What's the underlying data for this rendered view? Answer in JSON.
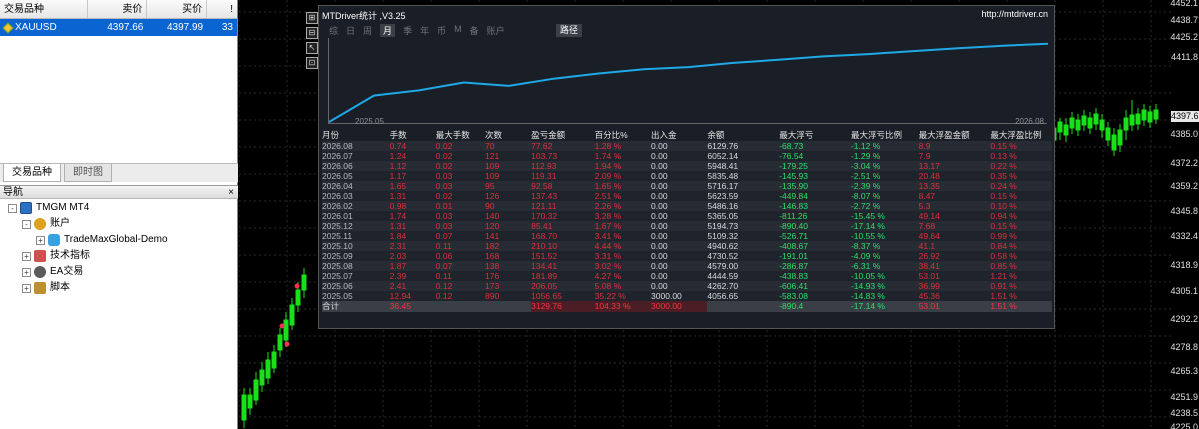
{
  "market_watch": {
    "headers": {
      "symbol": "交易品种",
      "bid": "卖价",
      "ask": "买价",
      "spread": "!"
    },
    "row": {
      "symbol": "XAUUSD",
      "bid": "4397.66",
      "ask": "4397.99",
      "spread": "33"
    },
    "tabs": [
      "交易品种",
      "即时图"
    ]
  },
  "navigator": {
    "title": "导航",
    "close": "×",
    "items": [
      {
        "label": "TMGM MT4",
        "level": 0,
        "expander": "-",
        "icon": "monitor-icon"
      },
      {
        "label": "账户",
        "level": 1,
        "expander": "-",
        "icon": "accounts-icon"
      },
      {
        "label": "TradeMaxGlobal-Demo",
        "level": 2,
        "expander": "+",
        "icon": "user-icon"
      },
      {
        "label": "技术指标",
        "level": 1,
        "expander": "+",
        "icon": "indicators-icon"
      },
      {
        "label": "EA交易",
        "level": 1,
        "expander": "+",
        "icon": "expert-icon"
      },
      {
        "label": "脚本",
        "level": 1,
        "expander": "+",
        "icon": "script-icon"
      }
    ]
  },
  "price_scale": {
    "ticks": [
      "4452.1",
      "4438.7",
      "4425.2",
      "4411.8",
      "4385.0",
      "4372.2",
      "4359.2",
      "4345.8",
      "4332.4",
      "4318.9",
      "4305.1",
      "4292.2",
      "4278.8",
      "4265.3",
      "4251.9",
      "4238.5",
      "4225.0"
    ],
    "current": "4397.6"
  },
  "toolbar": {
    "buttons": [
      "⊞",
      "⊟",
      "↖",
      "⊡"
    ]
  },
  "panel": {
    "title": "MTDriver统计 ,V3.25",
    "url": "http://mtdriver.cn",
    "period_tabs": [
      "综",
      "日",
      "周",
      "月",
      "季",
      "年",
      "币",
      "M",
      "备",
      "账户"
    ],
    "active_tab": "月",
    "path_button": "路径",
    "chart_x_start": "2025.05",
    "chart_x_end": "2026.08",
    "equity_curve": [
      3000,
      4056.65,
      4262.7,
      4579.0,
      4444.59,
      4730.52,
      4940.62,
      5109.32,
      5194.73,
      5365.05,
      5486.16,
      5623.59,
      5716.17,
      5835.48,
      5948.41,
      6052.14,
      6129.76
    ],
    "columns": [
      "月份",
      "手数",
      "最大手数",
      "次数",
      "盈亏金额",
      "百分比%",
      "出入金",
      "余额",
      "最大浮亏",
      "最大浮亏比例",
      "最大浮盈金额",
      "最大浮盈比例"
    ],
    "rows": [
      [
        "2026.08",
        "0.74",
        "0.02",
        "70",
        "77.62",
        "1.28 %",
        "0.00",
        "6129.76",
        "-68.73",
        "-1.12 %",
        "8.9",
        "0.15 %"
      ],
      [
        "2026.07",
        "1.24",
        "0.02",
        "121",
        "103.73",
        "1.74 %",
        "0.00",
        "6052.14",
        "-76.54",
        "-1.29 %",
        "7.9",
        "0.13 %"
      ],
      [
        "2026.06",
        "1.12",
        "0.02",
        "109",
        "112.93",
        "1.94 %",
        "0.00",
        "5948.41",
        "-179.25",
        "-3.04 %",
        "13.17",
        "0.22 %"
      ],
      [
        "2026.05",
        "1.17",
        "0.03",
        "109",
        "119.31",
        "2.09 %",
        "0.00",
        "5835.48",
        "-145.93",
        "-2.51 %",
        "20.48",
        "0.35 %"
      ],
      [
        "2026.04",
        "1.65",
        "0.03",
        "95",
        "92.58",
        "1.65 %",
        "0.00",
        "5716.17",
        "-135.90",
        "-2.39 %",
        "13.35",
        "0.24 %"
      ],
      [
        "2026.03",
        "1.31",
        "0.02",
        "126",
        "137.43",
        "2.51 %",
        "0.00",
        "5623.59",
        "-449.84",
        "-8.07 %",
        "8.47",
        "0.15 %"
      ],
      [
        "2026.02",
        "0.98",
        "0.01",
        "90",
        "121.11",
        "2.26 %",
        "0.00",
        "5486.16",
        "-146.83",
        "-2.72 %",
        "5.3",
        "0.10 %"
      ],
      [
        "2026.01",
        "1.74",
        "0.03",
        "140",
        "170.32",
        "3.28 %",
        "0.00",
        "5365.05",
        "-811.26",
        "-15.45 %",
        "49.14",
        "0.94 %"
      ],
      [
        "2025.12",
        "1.31",
        "0.03",
        "120",
        "85.41",
        "1.67 %",
        "0.00",
        "5194.73",
        "-890.40",
        "-17.14 %",
        "7.68",
        "0.15 %"
      ],
      [
        "2025.11",
        "1.84",
        "0.07",
        "141",
        "168.70",
        "3.41 %",
        "0.00",
        "5109.32",
        "-526.71",
        "-10.55 %",
        "49.64",
        "0.99 %"
      ],
      [
        "2025.10",
        "2.31",
        "0.11",
        "182",
        "210.10",
        "4.44 %",
        "0.00",
        "4940.62",
        "-408.67",
        "-8.37 %",
        "41.1",
        "0.84 %"
      ],
      [
        "2025.09",
        "2.03",
        "0.06",
        "168",
        "151.52",
        "3.31 %",
        "0.00",
        "4730.52",
        "-191.01",
        "-4.09 %",
        "26.92",
        "0.58 %"
      ],
      [
        "2025.08",
        "1.87",
        "0.07",
        "138",
        "134.41",
        "3.02 %",
        "0.00",
        "4579.00",
        "-286.87",
        "-6.31 %",
        "38.41",
        "0.85 %"
      ],
      [
        "2025.07",
        "2.39",
        "0.11",
        "176",
        "181.89",
        "4.27 %",
        "0.00",
        "4444.59",
        "-438.83",
        "-10.05 %",
        "53.01",
        "1.21 %"
      ],
      [
        "2025.06",
        "2.41",
        "0.12",
        "173",
        "206.05",
        "5.08 %",
        "0.00",
        "4262.70",
        "-606.41",
        "-14.93 %",
        "36.99",
        "0.91 %"
      ],
      [
        "2025.05",
        "12.94",
        "0.12",
        "890",
        "1056.65",
        "35.22 %",
        "3000.00",
        "4056.65",
        "-583.08",
        "-14.83 %",
        "45.36",
        "1.51 %"
      ]
    ],
    "total": [
      "合计",
      "36.45",
      "",
      "",
      "3129.76",
      "104.33 %",
      "3000.00",
      "",
      "-890.4",
      "-17.14 %",
      "53.01",
      "1.51 %"
    ]
  },
  "colors": {
    "bull": "#19e019",
    "bear": "#ffffff",
    "grid": "#2a2a2a",
    "equity": "#1fa9e6",
    "positive": "#2ee06a",
    "negative": "#e0303a"
  }
}
